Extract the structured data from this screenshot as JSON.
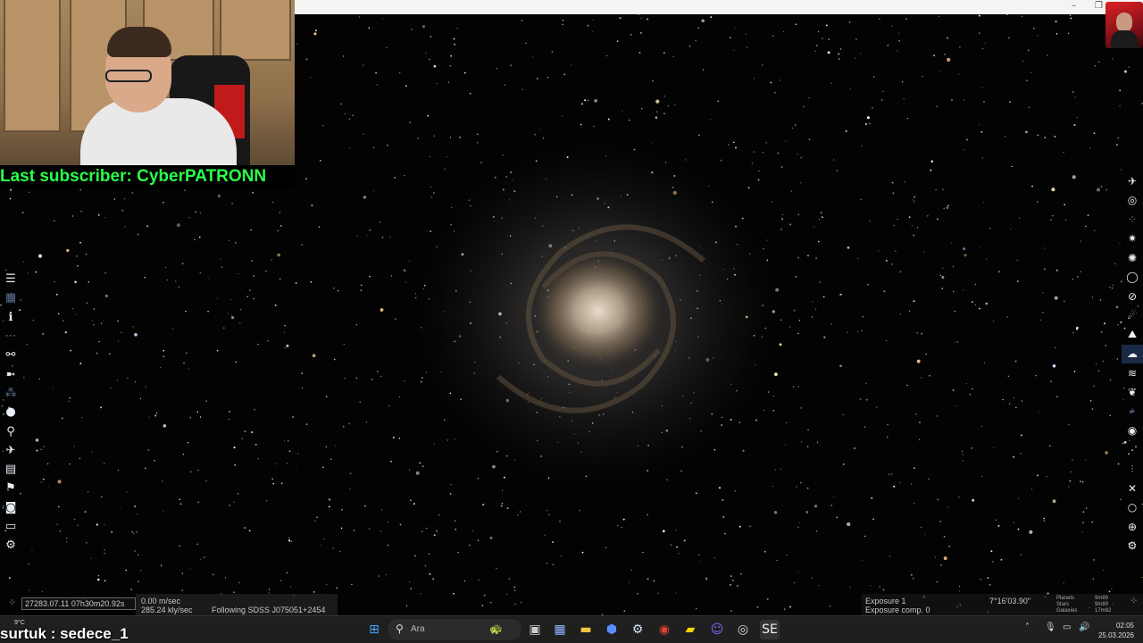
{
  "stream_overlay": {
    "subscriber_text": "Last subscriber: CyberPATRONN",
    "chat_user": "surtuk",
    "chat_message": "sedece_1"
  },
  "status": {
    "date_time": "27283.07.11 07h30m20.92s",
    "velocity": "0.00 m/sec",
    "velocity2": "285.24 kly/sec",
    "following": "Following SDSS J075051+2454",
    "exposure": "Exposure 1",
    "exposure_comp": "Exposure comp. 0",
    "fov": "7°16'03.90\"",
    "legend_labels": [
      "Planets",
      "Stars",
      "Galaxies"
    ],
    "legend_values": [
      "9m89",
      "9m89",
      "17m82"
    ]
  },
  "left_toolbar": [
    {
      "name": "menu-icon",
      "glyph": "☰"
    },
    {
      "name": "object-list-icon",
      "glyph": "▦"
    },
    {
      "name": "info-icon",
      "glyph": "ℹ"
    },
    {
      "name": "star-chart-icon",
      "glyph": "⋯"
    },
    {
      "name": "binoculars-icon",
      "glyph": "⚯"
    },
    {
      "name": "ship-icon",
      "glyph": "➼"
    },
    {
      "name": "constellation-icon",
      "glyph": "⁂"
    },
    {
      "name": "planet-icon",
      "glyph": "●"
    },
    {
      "name": "search-icon",
      "glyph": "⚲"
    },
    {
      "name": "spaceship-icon",
      "glyph": "✈"
    },
    {
      "name": "film-icon",
      "glyph": "▤"
    },
    {
      "name": "flag-icon",
      "glyph": "⚑"
    },
    {
      "name": "camera-icon",
      "glyph": "◙"
    },
    {
      "name": "monitor-icon",
      "glyph": "▭"
    },
    {
      "name": "settings-icon",
      "glyph": "⚙"
    }
  ],
  "right_toolbar": [
    {
      "name": "spaceship-mode-icon",
      "glyph": "✈"
    },
    {
      "name": "galaxy-icon",
      "glyph": "◎"
    },
    {
      "name": "nebula-icon",
      "glyph": "⁘"
    },
    {
      "name": "star-cluster-icon",
      "glyph": "✷"
    },
    {
      "name": "star-icon",
      "glyph": "✺"
    },
    {
      "name": "orbit-icon",
      "glyph": "◯"
    },
    {
      "name": "ring-planet-icon",
      "glyph": "⊘"
    },
    {
      "name": "comet-icon",
      "glyph": "☄"
    },
    {
      "name": "terrain-icon",
      "glyph": "⛰"
    },
    {
      "name": "clouds-icon",
      "glyph": "☁"
    },
    {
      "name": "water-icon",
      "glyph": "≋"
    },
    {
      "name": "life-icon",
      "glyph": "❦"
    },
    {
      "name": "coordinates-icon",
      "glyph": "⌖"
    },
    {
      "name": "eye-icon",
      "glyph": "◉"
    },
    {
      "name": "constellation-lines-icon",
      "glyph": "⋰"
    },
    {
      "name": "labels-icon",
      "glyph": "⁝"
    },
    {
      "name": "markers-icon",
      "glyph": "✕"
    },
    {
      "name": "circle-icon",
      "glyph": "○"
    },
    {
      "name": "grid-icon",
      "glyph": "⊕"
    },
    {
      "name": "settings-icon",
      "glyph": "⚙"
    }
  ],
  "taskbar": {
    "search_placeholder": "Ara",
    "weather_temp": "9°C",
    "time": "02:05",
    "date": "25.03.2026"
  }
}
